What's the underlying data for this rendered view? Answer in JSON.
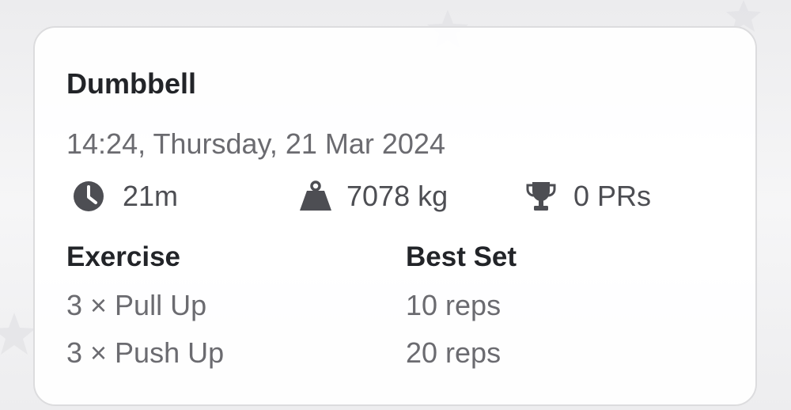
{
  "workout": {
    "title": "Dumbbell",
    "datetime": "14:24, Thursday, 21 Mar 2024",
    "stats": {
      "duration": "21m",
      "volume": "7078 kg",
      "prs": "0 PRs"
    },
    "table": {
      "headers": [
        "Exercise",
        "Best Set"
      ],
      "rows": [
        {
          "exercise": "3 × Pull Up",
          "best_set": "10 reps"
        },
        {
          "exercise": "3 × Push Up",
          "best_set": "20 reps"
        }
      ]
    }
  },
  "icons": {
    "duration": "clock-icon",
    "volume": "weight-icon",
    "prs": "trophy-icon"
  },
  "colors": {
    "title_text": "#222428",
    "secondary_text": "#6b6b70",
    "icon": "#4d4e53",
    "card_border": "#dcdcde"
  }
}
